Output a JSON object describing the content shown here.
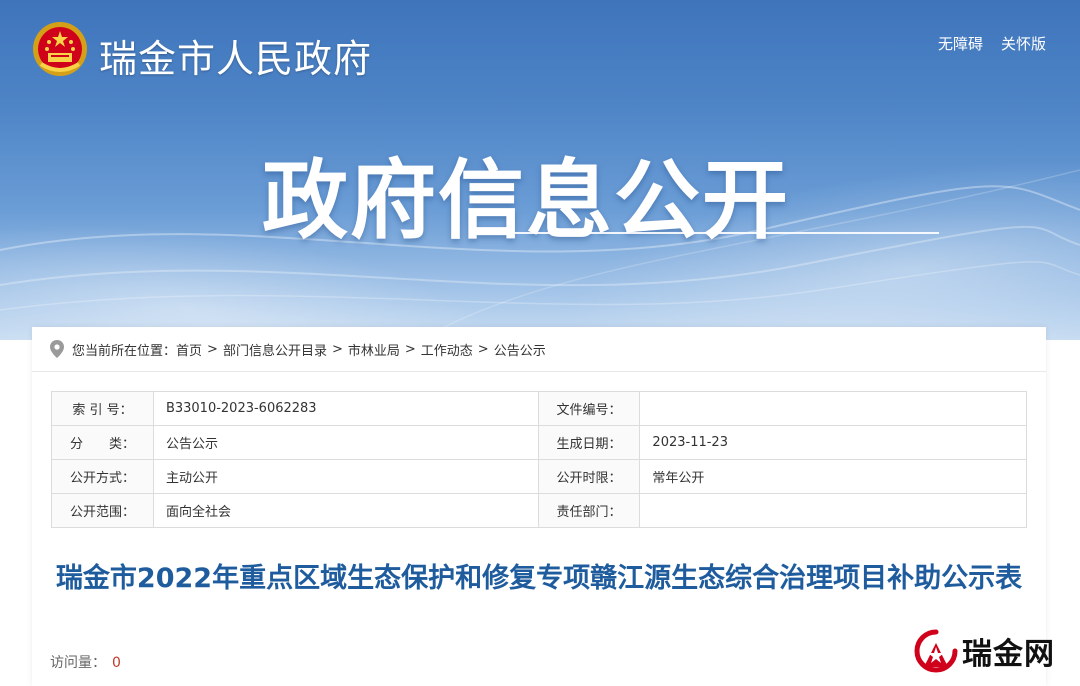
{
  "header": {
    "site_title": "瑞金市人民政府",
    "links": [
      "无障碍",
      "关怀版"
    ],
    "hero_title": "政府信息公开"
  },
  "breadcrumb": {
    "prefix": "您当前所在位置：",
    "items": [
      "首页",
      "部门信息公开目录",
      "市林业局",
      "工作动态",
      "公告公示"
    ],
    "separator": ">"
  },
  "meta": {
    "rows": [
      {
        "label1": "索 引 号：",
        "value1": "B33010-2023-6062283",
        "label2": "文件编号：",
        "value2": ""
      },
      {
        "label1": "分　　类：",
        "value1": "公告公示",
        "label2": "生成日期：",
        "value2": "2023-11-23"
      },
      {
        "label1": "公开方式：",
        "value1": "主动公开",
        "label2": "公开时限：",
        "value2": "常年公开"
      },
      {
        "label1": "公开范围：",
        "value1": "面向全社会",
        "label2": "责任部门：",
        "value2": ""
      }
    ]
  },
  "document": {
    "title": "瑞金市2022年重点区域生态保护和修复专项赣江源生态综合治理项目补助公示表",
    "visits_label": "访问量：",
    "visits_count": "0"
  },
  "watermark": {
    "text": "瑞金网"
  },
  "colors": {
    "header_blue": "#3f74bb",
    "title_blue": "#1f5c9e",
    "visits_red": "#c0392b"
  }
}
